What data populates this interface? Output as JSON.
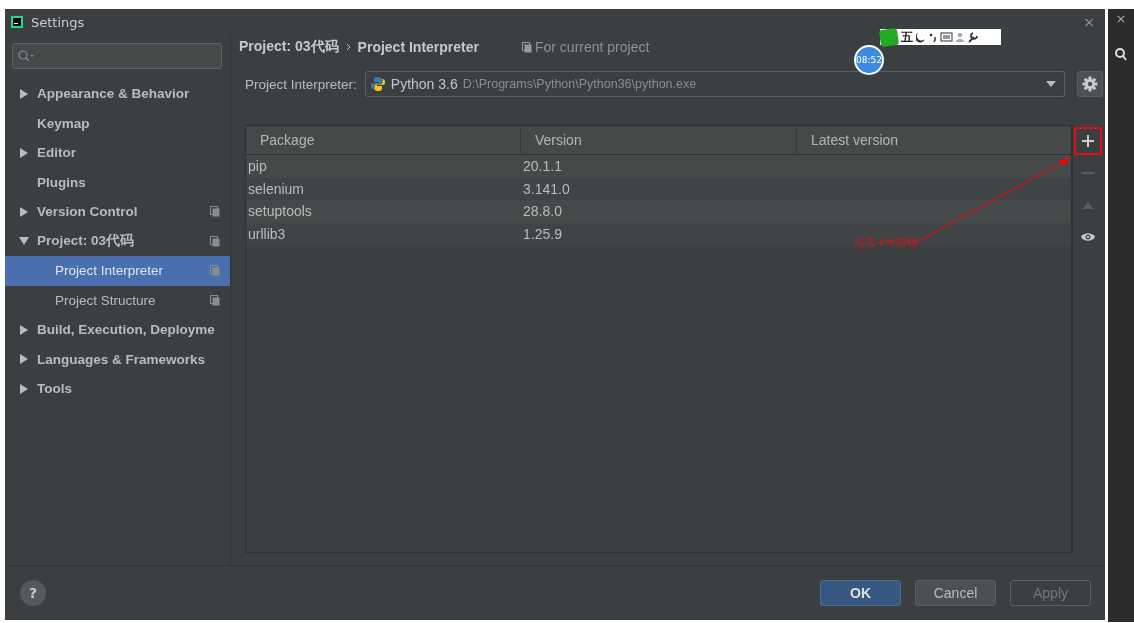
{
  "window": {
    "title": "Settings",
    "close": "×"
  },
  "sidebar": {
    "items": [
      {
        "label": "Appearance & Behavior",
        "kind": "group",
        "expanded": false,
        "shared": false,
        "selected": false
      },
      {
        "label": "Keymap",
        "kind": "page",
        "shared": false,
        "selected": false
      },
      {
        "label": "Editor",
        "kind": "group",
        "expanded": false,
        "shared": false,
        "selected": false
      },
      {
        "label": "Plugins",
        "kind": "page",
        "shared": false,
        "selected": false
      },
      {
        "label": "Version Control",
        "kind": "group",
        "expanded": false,
        "shared": true,
        "selected": false
      },
      {
        "label": "Project: 03代码",
        "kind": "group",
        "expanded": true,
        "shared": true,
        "selected": false,
        "children": [
          {
            "label": "Project Interpreter",
            "shared": true,
            "selected": true
          },
          {
            "label": "Project Structure",
            "shared": true,
            "selected": false
          }
        ]
      },
      {
        "label": "Build, Execution, Deployme",
        "kind": "group",
        "expanded": false,
        "shared": false,
        "selected": false
      },
      {
        "label": "Languages & Frameworks",
        "kind": "group",
        "expanded": false,
        "shared": false,
        "selected": false
      },
      {
        "label": "Tools",
        "kind": "group",
        "expanded": false,
        "shared": false,
        "selected": false
      }
    ]
  },
  "breadcrumb": [
    "Project: 03代码",
    "Project Interpreter"
  ],
  "scope": "For current project",
  "interpreter": {
    "label": "Project Interpreter:",
    "name": "Python 3.6",
    "path": "D:\\Programs\\Python\\Python36\\python.exe"
  },
  "table": {
    "columns": [
      "Package",
      "Version",
      "Latest version"
    ],
    "rows": [
      {
        "package": "pip",
        "version": "20.1.1"
      },
      {
        "package": "selenium",
        "version": "3.141.0"
      },
      {
        "package": "setuptools",
        "version": "28.8.0"
      },
      {
        "package": "urllib3",
        "version": "1.25.9"
      }
    ]
  },
  "table_tools": [
    {
      "kind": "add",
      "disabled": false,
      "highlighted": true
    },
    {
      "kind": "remove",
      "disabled": true,
      "highlighted": false
    },
    {
      "kind": "up",
      "disabled": true,
      "highlighted": false
    },
    {
      "kind": "show",
      "disabled": false,
      "highlighted": false
    }
  ],
  "annotation": "点击+号按钮",
  "footer": {
    "help": "?",
    "buttons": [
      {
        "label": "OK",
        "kind": "primary",
        "disabled": false
      },
      {
        "label": "Cancel",
        "kind": "normal",
        "disabled": false
      },
      {
        "label": "Apply",
        "kind": "normal",
        "disabled": true
      }
    ]
  },
  "overlay": {
    "clock": "08:52",
    "ime": "五"
  }
}
